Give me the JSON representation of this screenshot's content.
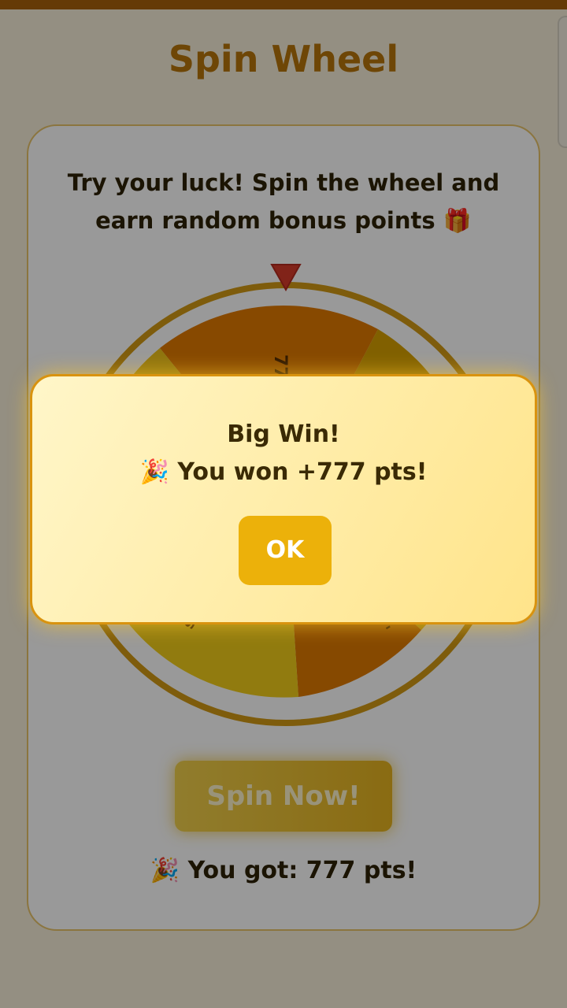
{
  "page": {
    "title": "Spin Wheel",
    "subtitle": "Try your luck! Spin the wheel and earn random bonus points 🎁"
  },
  "wheel": {
    "segment_labels": [
      "777 pts",
      "",
      "",
      "",
      "",
      ""
    ],
    "colors": {
      "orange": "#e27a00",
      "yellow": "#efc21a",
      "amber": "#d8a100",
      "rim": "#d39a14",
      "pointer": "#d83b2b"
    }
  },
  "actions": {
    "spin_label": "Spin Now!"
  },
  "result": {
    "emoji": "🎉",
    "text": "You got: 777 pts!"
  },
  "modal": {
    "title": "Big Win!",
    "emoji": "🎉",
    "message": "You won +777 pts!",
    "ok_label": "OK"
  }
}
